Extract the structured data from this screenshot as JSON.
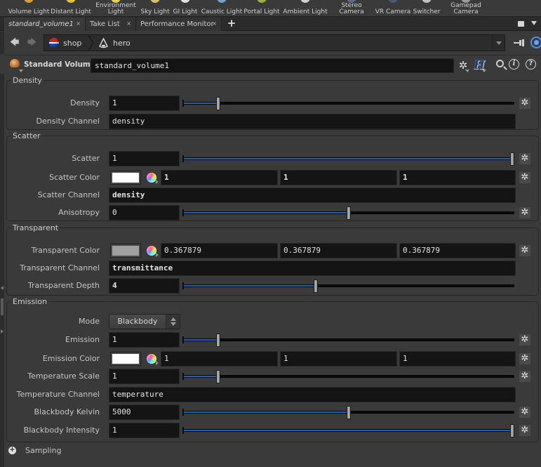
{
  "shelf": {
    "tools": [
      {
        "label": "Volume Light",
        "icon": "volume-light-icon",
        "color": "#d9a030"
      },
      {
        "label": "Distant Light",
        "icon": "distant-light-icon",
        "color": "#e0c040"
      },
      {
        "label": "Environment\nLight",
        "icon": "environment-light-icon",
        "color": "#e8d050"
      },
      {
        "label": "Sky Light",
        "icon": "sky-light-icon",
        "color": "#d9c070"
      },
      {
        "label": "GI Light",
        "icon": "gi-light-icon",
        "color": "#e0e0e0"
      },
      {
        "label": "Caustic Light",
        "icon": "caustic-light-icon",
        "color": "#7aa0d0"
      },
      {
        "label": "Portal Light",
        "icon": "portal-light-icon",
        "color": "#a0b040"
      },
      {
        "label": "Ambient Light",
        "icon": "ambient-light-icon",
        "color": "#cfcfcf"
      },
      {
        "label": "Stereo\nCamera",
        "icon": "stereo-camera-icon",
        "color": "#5a6a80"
      },
      {
        "label": "VR Camera",
        "icon": "vr-camera-icon",
        "color": "#4a5a70"
      },
      {
        "label": "Switcher",
        "icon": "switcher-icon",
        "color": "#c0c0c0"
      },
      {
        "label": "Gamepad\nCamera",
        "icon": "gamepad-camera-icon",
        "color": "#9a9a9a"
      }
    ]
  },
  "tabs": [
    {
      "label": "standard_volume1",
      "active": true,
      "close": "×"
    },
    {
      "label": "Take List",
      "active": false,
      "close": "×"
    },
    {
      "label": "Performance Monitor",
      "active": false,
      "close": "×"
    }
  ],
  "tab_add": "+",
  "nav": {
    "back": "🡄",
    "forward": "🡆"
  },
  "path": [
    {
      "label": "shop",
      "icon": "pepsi-logo-icon"
    },
    {
      "label": "hero",
      "icon": "cone-icon"
    }
  ],
  "node": {
    "type_label": "Standard Volume",
    "name": "standard_volume1",
    "help_i": "i",
    "help_q": "?"
  },
  "folders": {
    "density": {
      "title": "Density",
      "params": {
        "density": {
          "label": "Density",
          "value": "1",
          "slider_fraction": 0.1
        },
        "density_channel": {
          "label": "Density Channel",
          "value": "density"
        }
      }
    },
    "scatter": {
      "title": "Scatter",
      "params": {
        "scatter": {
          "label": "Scatter",
          "value": "1",
          "slider_fraction": 1.0
        },
        "scatter_color": {
          "label": "Scatter Color",
          "swatch": "#ffffff",
          "r": "1",
          "g": "1",
          "b": "1"
        },
        "scatter_channel": {
          "label": "Scatter Channel",
          "value": "density"
        },
        "anisotropy": {
          "label": "Anisotropy",
          "value": "0",
          "slider_fraction": 0.5
        }
      }
    },
    "transparent": {
      "title": "Transparent",
      "params": {
        "transparent_color": {
          "label": "Transparent Color",
          "swatch": "#a0a0a0",
          "r": "0.367879",
          "g": "0.367879",
          "b": "0.367879"
        },
        "transparent_channel": {
          "label": "Transparent Channel",
          "value": "transmittance"
        },
        "transparent_depth": {
          "label": "Transparent Depth",
          "value": "4",
          "slider_fraction": 0.4
        }
      }
    },
    "emission": {
      "title": "Emission",
      "params": {
        "mode": {
          "label": "Mode",
          "value": "Blackbody"
        },
        "emission": {
          "label": "Emission",
          "value": "1",
          "slider_fraction": 0.1
        },
        "emission_color": {
          "label": "Emission Color",
          "swatch": "#ffffff",
          "r": "1",
          "g": "1",
          "b": "1"
        },
        "temperature_scale": {
          "label": "Temperature Scale",
          "value": "1",
          "slider_fraction": 0.1
        },
        "temperature_channel": {
          "label": "Temperature Channel",
          "value": "temperature"
        },
        "blackbody_kelvin": {
          "label": "Blackbody Kelvin",
          "value": "5000",
          "slider_fraction": 0.5
        },
        "blackbody_intensity": {
          "label": "Blackbody Intensity",
          "value": "1",
          "slider_fraction": 1.0
        }
      }
    },
    "sampling": {
      "title": "Sampling",
      "collapsed": true
    }
  },
  "colors": {
    "accent_slider": "#1d64b8",
    "panel_bg": "#3a3a3a",
    "field_bg": "#141414"
  }
}
